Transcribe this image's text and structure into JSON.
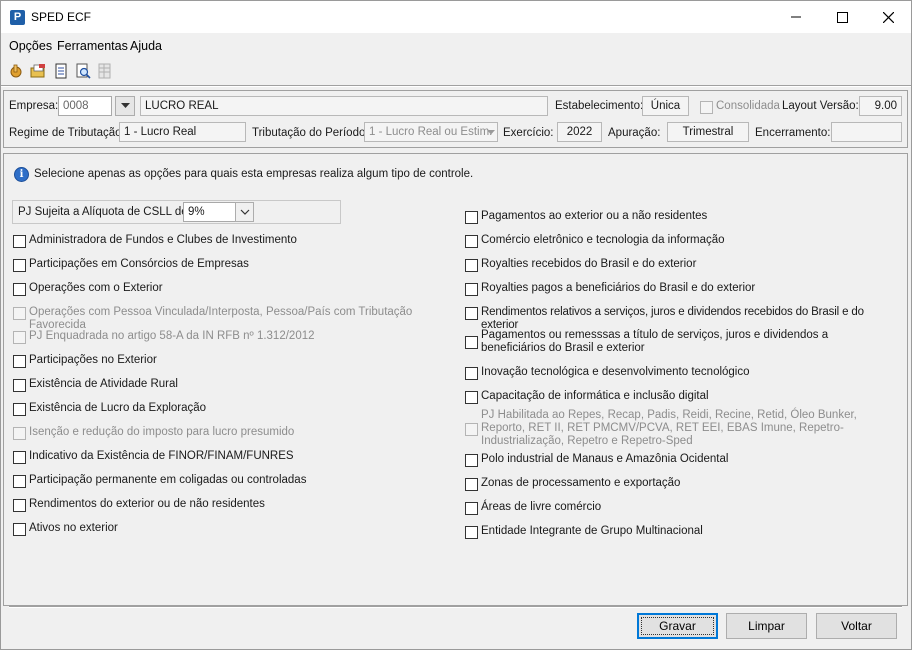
{
  "window": {
    "title": "SPED ECF",
    "app_icon": "P"
  },
  "menu": [
    "Opções",
    "Ferramentas",
    "Ajuda"
  ],
  "toolbar": [
    "hand-point-icon",
    "open-folder-icon",
    "document-icon",
    "search-document-icon",
    "grid-icon"
  ],
  "header": {
    "empresa_label": "Empresa:",
    "empresa_code": "0008",
    "empresa_name": "LUCRO REAL",
    "estabelecimento_label": "Estabelecimento:",
    "estabelecimento_value": "Única",
    "consolidada_label": "Consolidada",
    "layout_label": "Layout Versão:",
    "layout_value": "9.00",
    "regime_label": "Regime de Tributação:",
    "regime_value": "1 - Lucro Real",
    "tribut_periodo_label": "Tributação do Período:",
    "tribut_periodo_value": "1 - Lucro Real ou Estim.",
    "exercicio_label": "Exercício:",
    "exercicio_value": "2022",
    "apuracao_label": "Apuração:",
    "apuracao_value": "Trimestral",
    "encerramento_label": "Encerramento:",
    "encerramento_value": ""
  },
  "info_text": "Selecione apenas as opções para quais esta  empresas realiza algum tipo de controle.",
  "csll": {
    "label": "PJ Sujeita a Alíquota de CSLL de:",
    "value": "9%"
  },
  "left_options": [
    {
      "label": "Administradora de Fundos e Clubes de Investimento",
      "disabled": false
    },
    {
      "label": "Participações em Consórcios de Empresas",
      "disabled": false
    },
    {
      "label": "Operações com o Exterior",
      "disabled": false
    },
    {
      "label": "Operações com Pessoa Vinculada/Interposta, Pessoa/País com Tributação Favorecida",
      "disabled": true
    },
    {
      "label": "PJ Enquadrada no artigo 58-A da IN RFB nº 1.312/2012",
      "disabled": true
    },
    {
      "label": "Participações no Exterior",
      "disabled": false
    },
    {
      "label": "Existência de Atividade Rural",
      "disabled": false
    },
    {
      "label": "Existência de Lucro da Exploração",
      "disabled": false
    },
    {
      "label": "Isenção e redução do imposto para lucro presumido",
      "disabled": true
    },
    {
      "label": "Indicativo da Existência de FINOR/FINAM/FUNRES",
      "disabled": false
    },
    {
      "label": "Participação permanente em coligadas ou controladas",
      "disabled": false
    },
    {
      "label": "Rendimentos do exterior ou de não residentes",
      "disabled": false
    },
    {
      "label": "Ativos no exterior",
      "disabled": false
    }
  ],
  "right_options": [
    {
      "label": "Pagamentos ao exterior ou a não residentes",
      "disabled": false
    },
    {
      "label": "Comércio eletrônico e tecnologia da informação",
      "disabled": false
    },
    {
      "label": "Royalties recebidos do Brasil e do exterior",
      "disabled": false
    },
    {
      "label": "Royalties pagos a beneficiários do Brasil e do exterior",
      "disabled": false
    },
    {
      "label": "Rendimentos relativos a serviços, juros e dividendos recebidos do Brasil e do exterior",
      "disabled": false
    },
    {
      "label": "Pagamentos ou remesssas a título de serviços, juros e dividendos a beneficiários do Brasil e exterior",
      "disabled": false
    },
    {
      "label": "Inovação tecnológica e desenvolvimento tecnológico",
      "disabled": false
    },
    {
      "label": "Capacitação de informática e inclusão digital",
      "disabled": false
    },
    {
      "label": "PJ Habilitada ao Repes, Recap, Padis, Reidi, Recine, Retid, Óleo Bunker, Reporto, RET II, RET PMCMV/PCVA, RET EEI, EBAS Imune, Repetro-Industrialização, Repetro e Repetro-Sped",
      "disabled": true
    },
    {
      "label": "Polo industrial de Manaus e Amazônia Ocidental",
      "disabled": false
    },
    {
      "label": "Zonas de processamento e exportação",
      "disabled": false
    },
    {
      "label": "Áreas de livre comércio",
      "disabled": false
    },
    {
      "label": "Entidade Integrante de Grupo Multinacional",
      "disabled": false
    }
  ],
  "buttons": {
    "gravar": "Gravar",
    "limpar": "Limpar",
    "voltar": "Voltar"
  }
}
